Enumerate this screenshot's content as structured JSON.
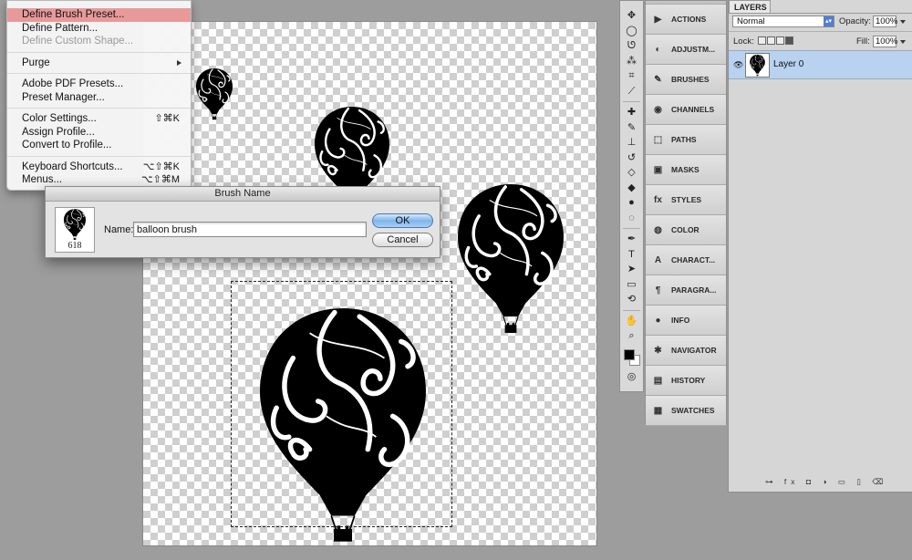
{
  "edit_menu": {
    "items": [
      {
        "label": "Define Brush Preset...",
        "shortcut": "",
        "state": "highlighted"
      },
      {
        "label": "Define Pattern...",
        "shortcut": "",
        "state": "normal"
      },
      {
        "label": "Define Custom Shape...",
        "shortcut": "",
        "state": "disabled"
      },
      {
        "label": "Purge",
        "shortcut": "",
        "state": "submenu"
      },
      {
        "label": "Adobe PDF Presets...",
        "shortcut": "",
        "state": "normal"
      },
      {
        "label": "Preset Manager...",
        "shortcut": "",
        "state": "normal"
      },
      {
        "label": "Color Settings...",
        "shortcut": "⇧⌘K",
        "state": "normal"
      },
      {
        "label": "Assign Profile...",
        "shortcut": "",
        "state": "normal"
      },
      {
        "label": "Convert to Profile...",
        "shortcut": "",
        "state": "normal"
      },
      {
        "label": "Keyboard Shortcuts...",
        "shortcut": "⌥⇧⌘K",
        "state": "normal"
      },
      {
        "label": "Menus...",
        "shortcut": "⌥⇧⌘M",
        "state": "normal"
      }
    ]
  },
  "dialog": {
    "title": "Brush Name",
    "brush_size": "618",
    "name_label": "Name:",
    "name_value": "balloon brush",
    "ok_label": "OK",
    "cancel_label": "Cancel"
  },
  "dock": {
    "items": [
      {
        "label": "ACTIONS",
        "icon": "actions-icon",
        "glyph": "▶"
      },
      {
        "label": "ADJUSTM...",
        "icon": "adjustments-icon",
        "glyph": "◐"
      },
      {
        "label": "BRUSHES",
        "icon": "brushes-icon",
        "glyph": "✎"
      },
      {
        "label": "CHANNELS",
        "icon": "channels-icon",
        "glyph": "◉"
      },
      {
        "label": "PATHS",
        "icon": "paths-icon",
        "glyph": "⬚"
      },
      {
        "label": "MASKS",
        "icon": "masks-icon",
        "glyph": "▣"
      },
      {
        "label": "STYLES",
        "icon": "styles-icon",
        "glyph": "fx"
      },
      {
        "label": "COLOR",
        "icon": "color-icon",
        "glyph": "◍"
      },
      {
        "label": "CHARACT...",
        "icon": "character-icon",
        "glyph": "A"
      },
      {
        "label": "PARAGRA...",
        "icon": "paragraph-icon",
        "glyph": "¶"
      },
      {
        "label": "INFO",
        "icon": "info-icon",
        "glyph": "●"
      },
      {
        "label": "NAVIGATOR",
        "icon": "navigator-icon",
        "glyph": "✱"
      },
      {
        "label": "HISTORY",
        "icon": "history-icon",
        "glyph": "▤"
      },
      {
        "label": "SWATCHES",
        "icon": "swatches-icon",
        "glyph": "▦"
      }
    ]
  },
  "layers": {
    "tab_label": "LAYERS",
    "blend_mode": "Normal",
    "opacity_label": "Opacity:",
    "opacity_value": "100%",
    "lock_label": "Lock:",
    "fill_label": "Fill:",
    "fill_value": "100%",
    "layer_name": "Layer 0",
    "footer_icons": "⊶ fx ◘ ◑ ▭ ▯ ⌫"
  }
}
